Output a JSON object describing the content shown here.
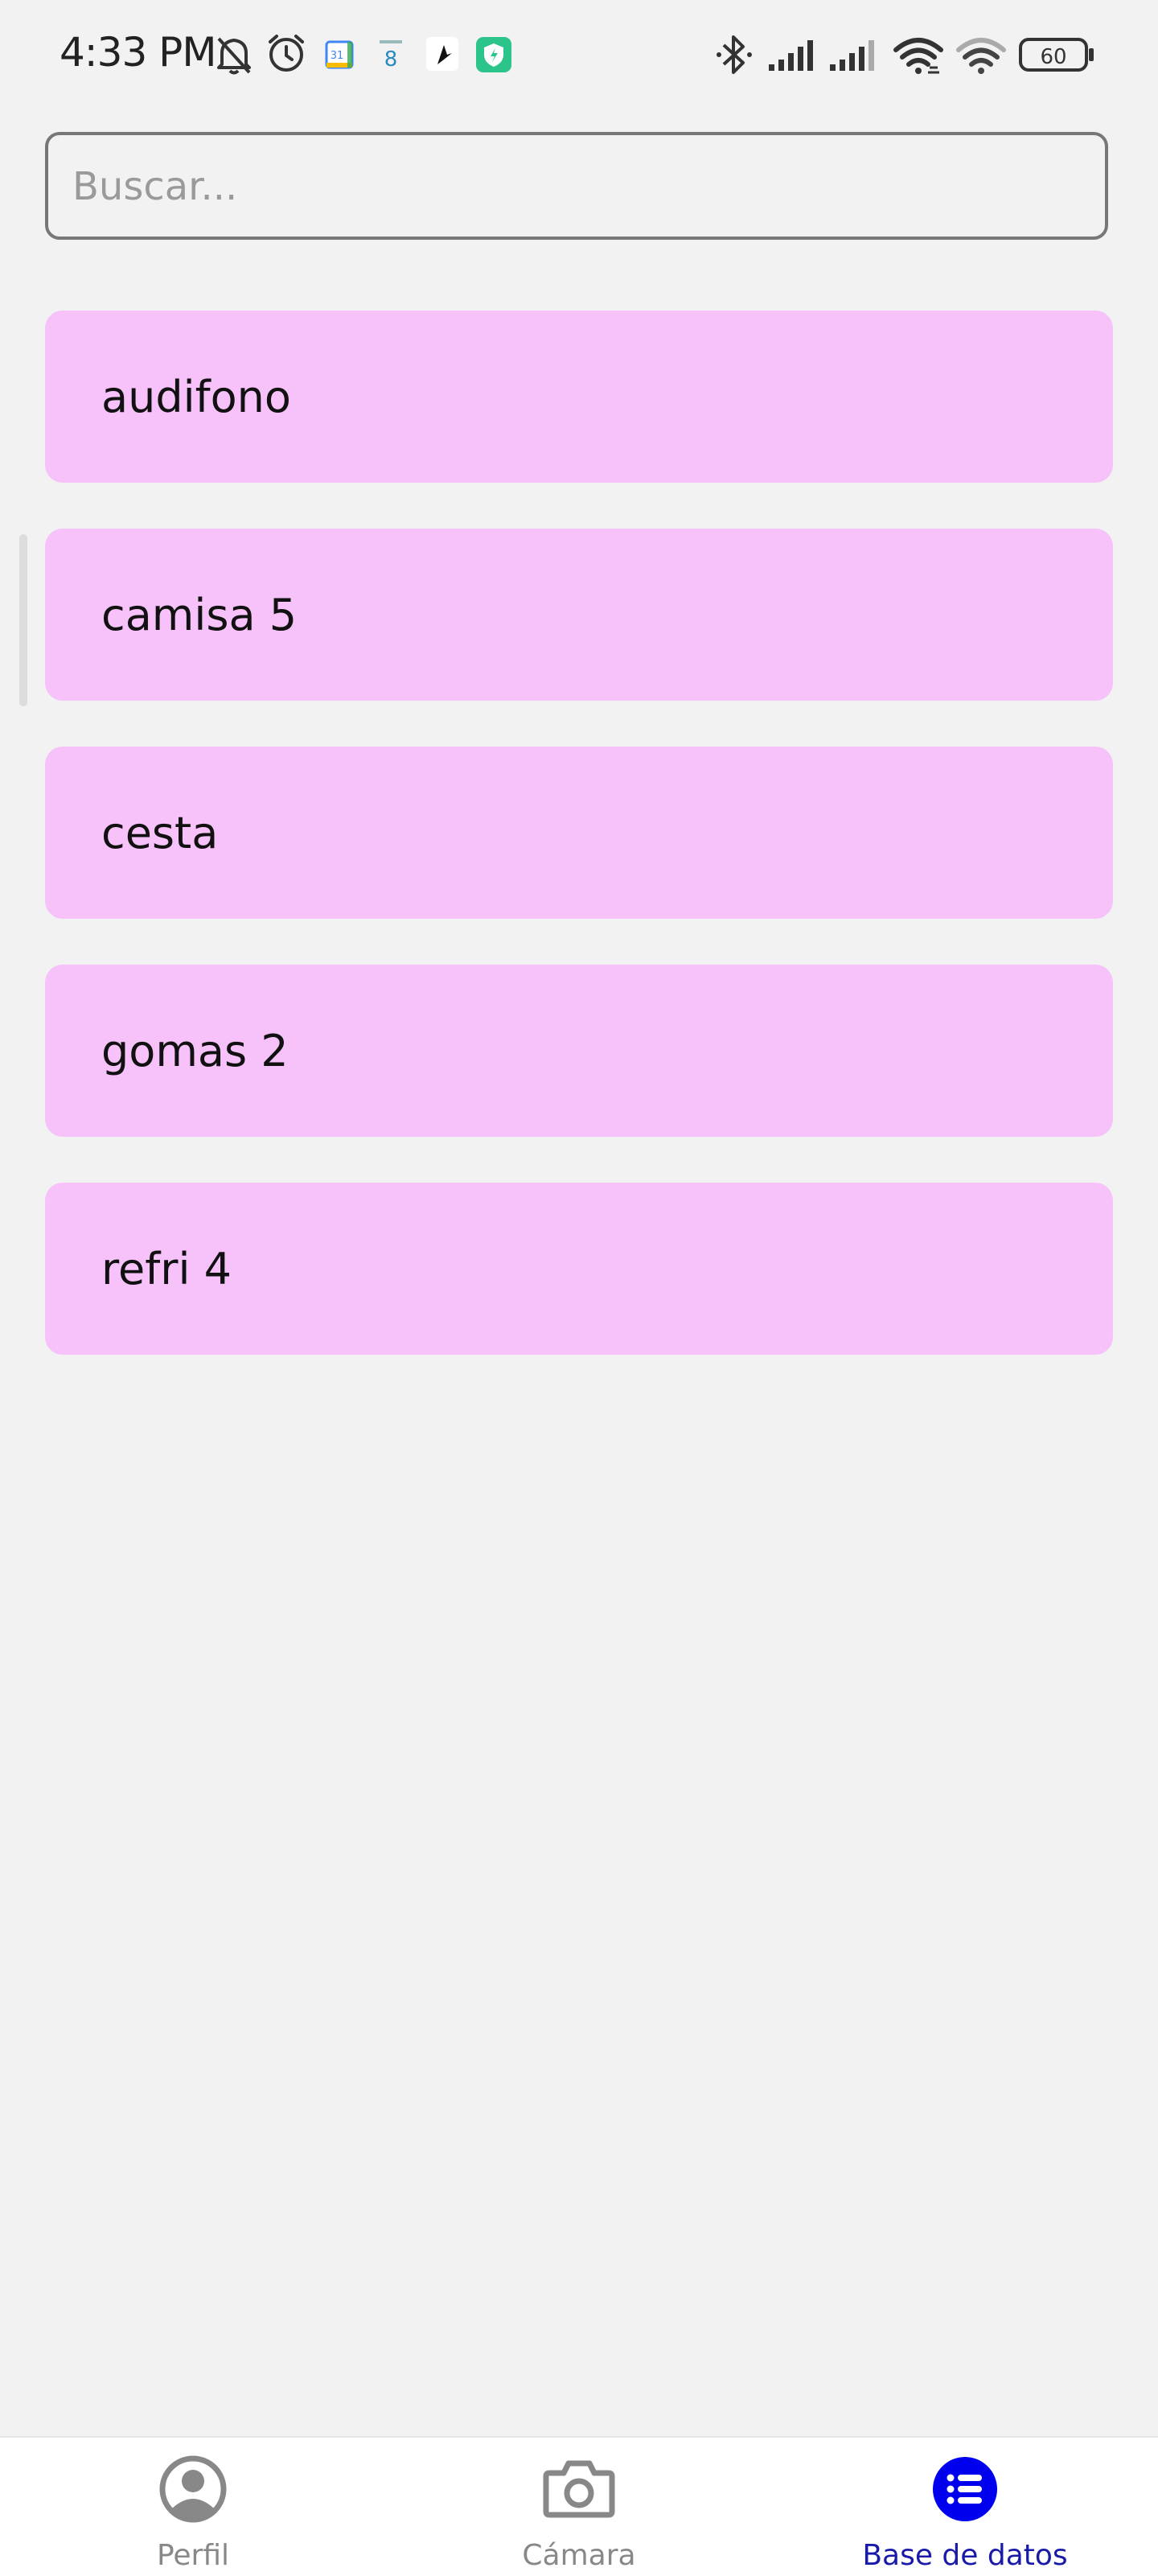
{
  "status_bar": {
    "time": "4:33 PM",
    "left_icons": [
      "mute-bell-icon",
      "alarm-icon",
      "calendar-icon",
      "calendar-date-icon",
      "app-icon",
      "shield-app-icon"
    ],
    "calendar_day": "31",
    "date_day": "8",
    "right_icons": [
      "bluetooth-icon",
      "signal-icon",
      "signal-icon",
      "wifi-icon",
      "wifi-icon",
      "battery-icon"
    ],
    "battery_level": "60"
  },
  "search": {
    "placeholder": "Buscar...",
    "value": ""
  },
  "items": [
    {
      "label": "audifono"
    },
    {
      "label": "camisa 5"
    },
    {
      "label": "cesta"
    },
    {
      "label": "gomas 2"
    },
    {
      "label": "refri 4"
    }
  ],
  "colors": {
    "background": "#f2f2f2",
    "item_background": "#f7c1fa",
    "active_nav": "#0000ee",
    "active_label": "#1a1aa8",
    "inactive_nav": "#888888"
  },
  "bottom_nav": {
    "items": [
      {
        "label": "Perfil",
        "icon": "profile-icon",
        "active": false
      },
      {
        "label": "Cámara",
        "icon": "camera-icon",
        "active": false
      },
      {
        "label": "Base de datos",
        "icon": "list-icon",
        "active": true
      }
    ]
  }
}
